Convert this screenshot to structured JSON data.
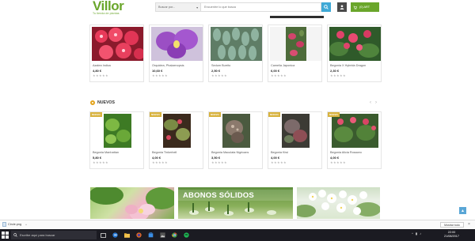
{
  "header": {
    "logo_text": "Villor",
    "logo_tagline": "Tu tienda de plantas",
    "search_category": "Buscar por...",
    "search_placeholder": "Encuentre lo que busca",
    "cart_label": "(0) ART"
  },
  "top_products": [
    {
      "name": "Azalea Indica",
      "price": "4,80 €",
      "rating": "★★★★★"
    },
    {
      "name": "Orquidea, Phalaenopsis",
      "price": "10,60 €",
      "rating": "★★★★★"
    },
    {
      "name": "Sedum Burrito",
      "price": "2,50 €",
      "rating": "★★★★★"
    },
    {
      "name": "Camelia Japonica",
      "price": "6,00 €",
      "rating": "★★★★★"
    },
    {
      "name": "Begonia X Hybrida Dragon",
      "price": "2,30 €",
      "rating": "★★★★★"
    }
  ],
  "new_section": {
    "title": "NUEVOS",
    "prev_arrow": "‹",
    "next_arrow": "›"
  },
  "new_products": [
    {
      "badge": "NUEVO",
      "name": "Begonia Manhattan",
      "price": "5,80 €",
      "rating": "★★★★★"
    },
    {
      "badge": "NUEVO",
      "name": "Begonia Tinkerbell",
      "price": "4,00 €",
      "rating": "★★★★★"
    },
    {
      "badge": "NUEVO",
      "name": "Begonia Maculata Nigricans",
      "price": "3,50 €",
      "rating": "★★★★★"
    },
    {
      "badge": "NUEVO",
      "name": "Begonia Kiwi",
      "price": "4,00 €",
      "rating": "★★★★★"
    },
    {
      "badge": "NUEVO",
      "name": "Begonia Alicia Rosaceo",
      "price": "4,00 €",
      "rating": "★★★★★"
    }
  ],
  "banners": {
    "middle_title": "ABONOS SÓLIDOS"
  },
  "scroll_top_icon": "arrow-up-icon",
  "download_bar": {
    "file_name": "Circle.png",
    "show_all": "Mostrar todo",
    "close": "×"
  },
  "taskbar": {
    "search_text": "Escribe aquí para buscar",
    "time": "22:00",
    "date": "21/08/2017"
  }
}
